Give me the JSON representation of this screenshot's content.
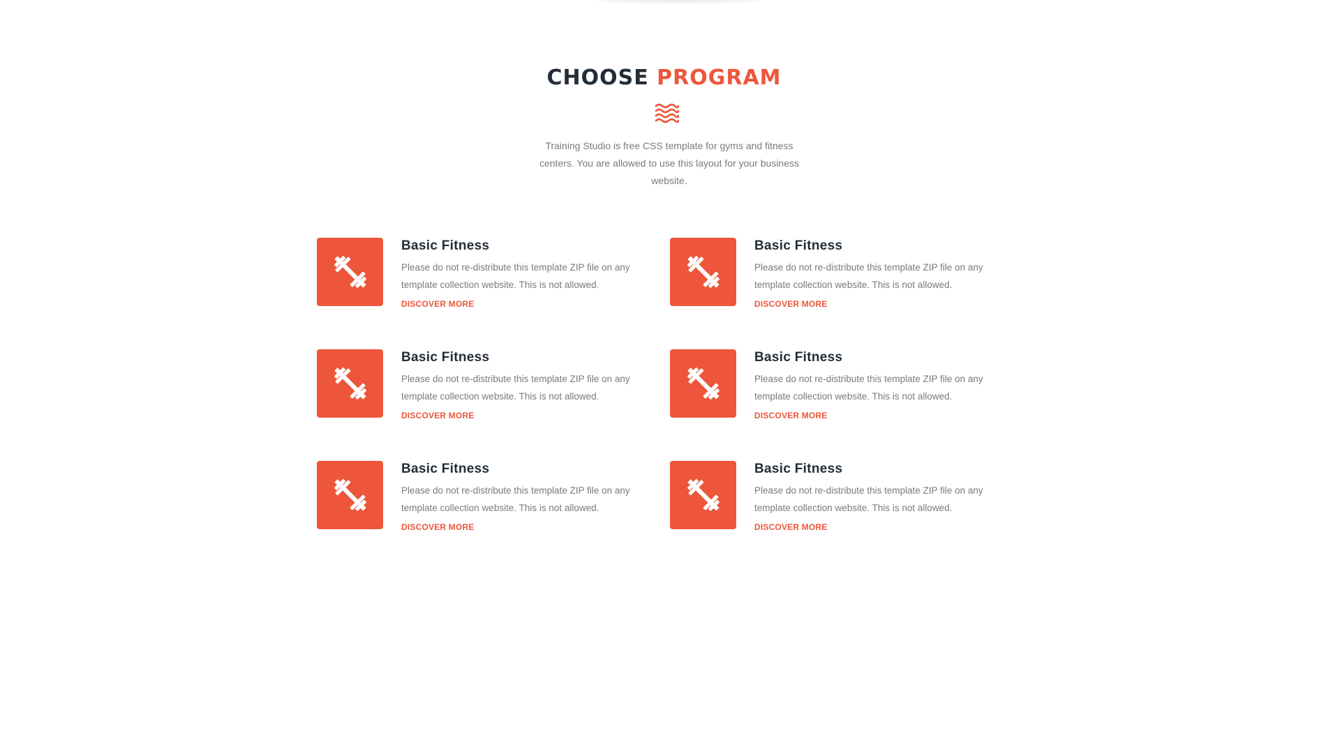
{
  "section": {
    "title_dark": "CHOOSE",
    "title_accent": "PROGRAM",
    "divider_icon": "waves-icon",
    "intro": "Training Studio is free CSS template for gyms and fitness centers. You are allowed to use this layout for your business website."
  },
  "programs": [
    {
      "icon": "dumbbell-icon",
      "title": "Basic Fitness",
      "text": "Please do not re-distribute this template ZIP file on any template collection website. This is not allowed.",
      "link": "DISCOVER MORE"
    },
    {
      "icon": "dumbbell-icon",
      "title": "Basic Fitness",
      "text": "Please do not re-distribute this template ZIP file on any template collection website. This is not allowed.",
      "link": "DISCOVER MORE"
    },
    {
      "icon": "dumbbell-icon",
      "title": "Basic Fitness",
      "text": "Please do not re-distribute this template ZIP file on any template collection website. This is not allowed.",
      "link": "DISCOVER MORE"
    },
    {
      "icon": "dumbbell-icon",
      "title": "Basic Fitness",
      "text": "Please do not re-distribute this template ZIP file on any template collection website. This is not allowed.",
      "link": "DISCOVER MORE"
    },
    {
      "icon": "dumbbell-icon",
      "title": "Basic Fitness",
      "text": "Please do not re-distribute this template ZIP file on any template collection website. This is not allowed.",
      "link": "DISCOVER MORE"
    },
    {
      "icon": "dumbbell-icon",
      "title": "Basic Fitness",
      "text": "Please do not re-distribute this template ZIP file on any template collection website. This is not allowed.",
      "link": "DISCOVER MORE"
    }
  ],
  "colors": {
    "accent": "#ed563b",
    "heading": "#232d39",
    "body_text": "#7a7a7a",
    "background": "#ffffff"
  }
}
